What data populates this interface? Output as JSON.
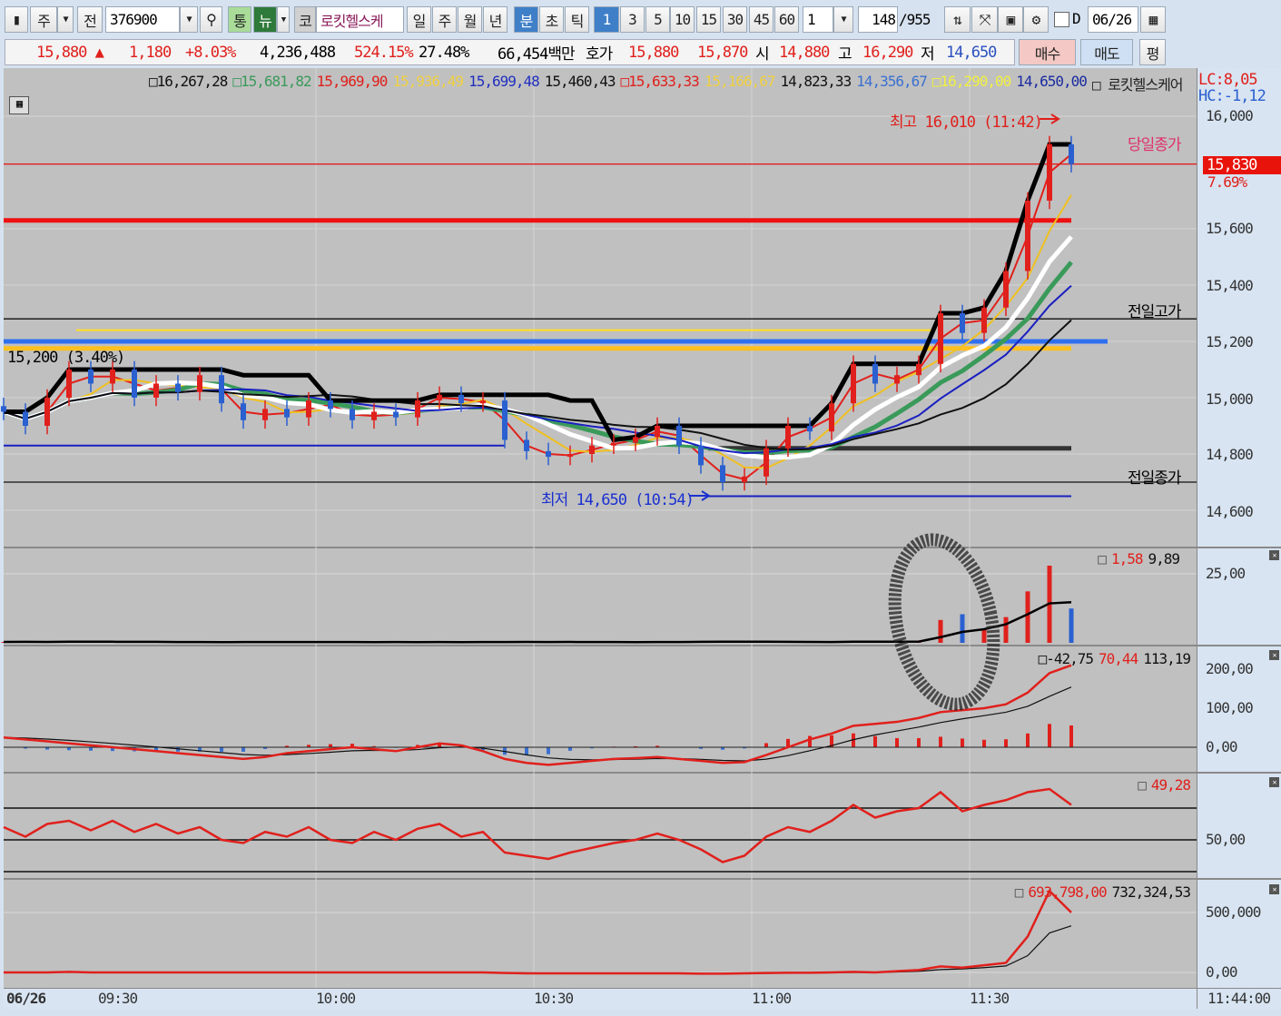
{
  "toolbar": {
    "screen_type": "주",
    "prev": "전",
    "code": "376900",
    "tong": "통",
    "news": "뉴",
    "ko": "코",
    "name": "로킷헬스케",
    "periods": [
      "일",
      "주",
      "월",
      "년",
      "분",
      "초",
      "틱"
    ],
    "minutes": [
      "1",
      "3",
      "5",
      "10",
      "15",
      "30",
      "45",
      "60"
    ],
    "interval": "1",
    "count": "148",
    "total": "/955",
    "d_label": "D",
    "date": "06/26"
  },
  "quote": {
    "price": "15,880",
    "arrow": "▲",
    "change": "1,180",
    "pct": "+8.03%",
    "volume": "4,236,488",
    "vol_ratio": "524.15%",
    "turnover": "27.48%",
    "amount": "66,454백만",
    "hoga_label": "호가",
    "ask": "15,880",
    "bid": "15,870",
    "open_label": "시",
    "open": "14,880",
    "high_label": "고",
    "high": "16,290",
    "low_label": "저",
    "low": "14,650",
    "buy": "매수",
    "sell": "매도",
    "avg": "평"
  },
  "legend": [
    {
      "text": "□16,267,28",
      "color": "#111111"
    },
    {
      "text": "□15,681,82",
      "color": "#3a9a5a"
    },
    {
      "text": "15,969,90",
      "color": "#e0201c"
    },
    {
      "text": "15,936,49",
      "color": "#f0d040"
    },
    {
      "text": "15,699,48",
      "color": "#2030c0"
    },
    {
      "text": "15,460,43",
      "color": "#111111"
    },
    {
      "text": "□15,633,33",
      "color": "#e0201c"
    },
    {
      "text": "15,166,67",
      "color": "#f0d040"
    },
    {
      "text": "14,823,33",
      "color": "#111111"
    },
    {
      "text": "14,356,67",
      "color": "#3a70d0"
    },
    {
      "text": "□16,290,00",
      "color": "#f0f040"
    },
    {
      "text": "14,650,00",
      "color": "#1a2aa0"
    },
    {
      "text": "□ 로킷헬스케어",
      "color": "#222222"
    }
  ],
  "lc": "LC:8,05",
  "hc": "HC:-1,12",
  "annotations": {
    "high": "최고 16,010 (11:42)",
    "low": "최저 14,650 (10:54)",
    "left": "15,200 (3.40%)"
  },
  "current": {
    "price": "15,830",
    "pct": "7.69%"
  },
  "axis": {
    "main": [
      "16,000",
      "15,600",
      "15,400",
      "15,200",
      "15,000",
      "14,800",
      "14,600"
    ],
    "vol": [
      "25,00"
    ],
    "macd": [
      "200,00",
      "100,00",
      "0,00"
    ],
    "osc": [
      "50,00"
    ],
    "obv": [
      "500,000",
      "0,00"
    ],
    "time": [
      "06/26",
      "09:30",
      "10:00",
      "10:30",
      "11:00",
      "11:30",
      "11:44:00"
    ]
  },
  "sub_legends": {
    "vol": [
      {
        "text": "□",
        "color": "#555"
      },
      {
        "text": "1,58",
        "color": "#e0201c"
      },
      {
        "text": "9,89",
        "color": "#111"
      }
    ],
    "macd": [
      {
        "text": "□-42,75",
        "color": "#111"
      },
      {
        "text": "70,44",
        "color": "#e0201c"
      },
      {
        "text": "113,19",
        "color": "#111"
      }
    ],
    "osc": [
      {
        "text": "□",
        "color": "#555"
      },
      {
        "text": "49,28",
        "color": "#e0201c"
      }
    ],
    "obv": [
      {
        "text": "□",
        "color": "#555"
      },
      {
        "text": "693,798,00",
        "color": "#e0201c"
      },
      {
        "text": "732,324,53",
        "color": "#111"
      }
    ]
  },
  "chart_data": {
    "type": "candlestick",
    "interval_minutes": 3,
    "start_time": "09:17",
    "closes": [
      14950,
      14900,
      15000,
      15100,
      15050,
      15100,
      15000,
      15050,
      15020,
      15080,
      14980,
      14920,
      14960,
      14930,
      14990,
      14960,
      14920,
      14950,
      14930,
      14990,
      15010,
      14980,
      14990,
      14850,
      14810,
      14790,
      14800,
      14830,
      14840,
      14860,
      14900,
      14830,
      14760,
      14700,
      14720,
      14820,
      14900,
      14880,
      14980,
      15120,
      15050,
      15080,
      15120,
      15300,
      15230,
      15320,
      15450,
      15700,
      15900,
      15830
    ],
    "volume": [
      0.3,
      0.4,
      0.3,
      0.6,
      0.3,
      0.3,
      0.2,
      0.3,
      0.2,
      0.3,
      0.2,
      0.3,
      0.3,
      0.2,
      0.3,
      0.2,
      0.3,
      0.2,
      0.3,
      0.2,
      0.3,
      0.2,
      0.3,
      0.4,
      0.3,
      0.2,
      0.3,
      0.2,
      0.3,
      0.2,
      0.3,
      0.4,
      0.6,
      0.4,
      0.3,
      0.3,
      0.2,
      0.3,
      0.3,
      0.8,
      0.3,
      0.3,
      0.5,
      8,
      10,
      5,
      9,
      18,
      27,
      12
    ],
    "macd": [
      25,
      20,
      15,
      10,
      5,
      0,
      -5,
      -10,
      -15,
      -20,
      -25,
      -30,
      -25,
      -15,
      -10,
      -5,
      0,
      -5,
      -10,
      0,
      10,
      5,
      -10,
      -30,
      -40,
      -45,
      -40,
      -35,
      -30,
      -28,
      -25,
      -30,
      -35,
      -40,
      -38,
      -20,
      0,
      20,
      35,
      55,
      60,
      65,
      75,
      90,
      95,
      100,
      110,
      140,
      190,
      210
    ],
    "oscillator": [
      58,
      52,
      60,
      62,
      56,
      62,
      55,
      60,
      54,
      58,
      50,
      48,
      55,
      52,
      58,
      50,
      48,
      55,
      50,
      57,
      60,
      52,
      55,
      42,
      40,
      38,
      42,
      45,
      48,
      50,
      54,
      50,
      44,
      36,
      40,
      52,
      58,
      55,
      62,
      72,
      64,
      68,
      70,
      80,
      68,
      72,
      75,
      80,
      82,
      72
    ],
    "obv": [
      0,
      0,
      0,
      5000,
      0,
      0,
      0,
      0,
      0,
      0,
      0,
      0,
      0,
      0,
      0,
      0,
      0,
      0,
      0,
      0,
      0,
      0,
      0,
      -5000,
      -8000,
      -8000,
      -8000,
      -8000,
      -8000,
      -8000,
      -8000,
      -8000,
      -10000,
      -10000,
      -8000,
      -5000,
      -3000,
      -3000,
      0,
      5000,
      0,
      10000,
      20000,
      50000,
      40000,
      60000,
      80000,
      300000,
      680000,
      500000
    ],
    "levels": [
      {
        "label": "당일종가",
        "price": 15830,
        "color": "#e0201c",
        "style": "thin"
      },
      {
        "label": "전일고가",
        "price": 15280,
        "color": "#111111",
        "style": "thin"
      },
      {
        "label": "전일종가",
        "price": 14700,
        "color": "#111111",
        "style": "thin"
      }
    ],
    "lines": [
      {
        "price": 15630,
        "color": "#ee1010",
        "style": "thick",
        "from": "09:17",
        "to": "11:44"
      },
      {
        "price": 15240,
        "color": "#ffe020",
        "style": "thin",
        "from": "09:27",
        "to": "11:25"
      },
      {
        "price": 15175,
        "color": "#ffc020",
        "style": "thick",
        "from": "09:17",
        "to": "11:44"
      },
      {
        "price": 15200,
        "color": "#3070f0",
        "style": "thick",
        "from": "09:17",
        "to": "11:49"
      },
      {
        "price": 14820,
        "color": "#333333",
        "style": "thick",
        "from": "10:54",
        "to": "11:44"
      },
      {
        "price": 14830,
        "color": "#1a20c0",
        "style": "thin",
        "from": "09:17",
        "to": "10:26"
      },
      {
        "price": 14650,
        "color": "#1a20c0",
        "style": "thin",
        "from": "10:54",
        "to": "11:44"
      }
    ],
    "ma": [
      {
        "period": 2,
        "color": "#e0201c"
      },
      {
        "period": 4,
        "color": "#f0c020"
      },
      {
        "period": 8,
        "color": "#3a9a5a",
        "style": "thick"
      },
      {
        "period": 6,
        "color": "#ffffff",
        "style": "thick"
      },
      {
        "period": 10,
        "color": "#1a20c0"
      },
      {
        "period": 14,
        "color": "#111111"
      }
    ],
    "up_color": "#e0201c",
    "down_color": "#2a60d0"
  }
}
